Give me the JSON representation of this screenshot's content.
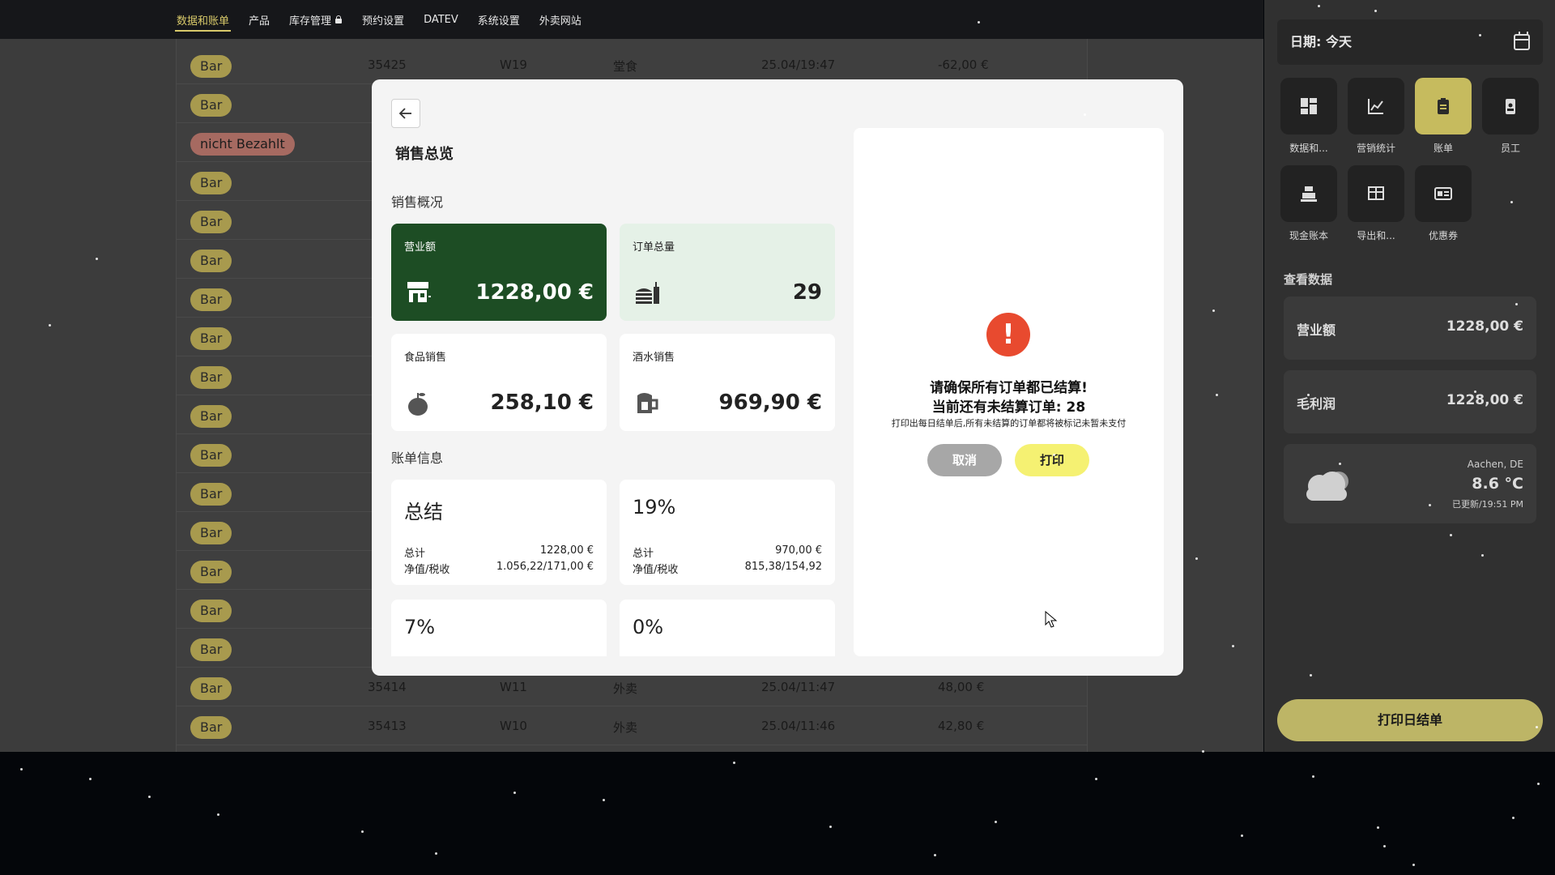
{
  "topnav": {
    "items": [
      {
        "label": "数据和账单",
        "active": true
      },
      {
        "label": "产品"
      },
      {
        "label": "库存管理",
        "locked": true
      },
      {
        "label": "预约设置"
      },
      {
        "label": "DATEV"
      },
      {
        "label": "系统设置"
      },
      {
        "label": "外卖网站"
      }
    ]
  },
  "orders": [
    {
      "status": "Bar",
      "id": "35425",
      "table": "W19",
      "type": "堂食",
      "time": "25.04/19:47",
      "amount": "-62,00 €"
    },
    {
      "status": "Bar"
    },
    {
      "status": "nicht Bezahlt"
    },
    {
      "status": "Bar"
    },
    {
      "status": "Bar"
    },
    {
      "status": "Bar"
    },
    {
      "status": "Bar"
    },
    {
      "status": "Bar"
    },
    {
      "status": "Bar"
    },
    {
      "status": "Bar"
    },
    {
      "status": "Bar"
    },
    {
      "status": "Bar"
    },
    {
      "status": "Bar"
    },
    {
      "status": "Bar"
    },
    {
      "status": "Bar"
    },
    {
      "status": "Bar"
    },
    {
      "status": "Bar",
      "id": "35414",
      "table": "W11",
      "type": "外卖",
      "time": "25.04/11:47",
      "amount": "48,00 €"
    },
    {
      "status": "Bar",
      "id": "35413",
      "table": "W10",
      "type": "外卖",
      "time": "25.04/11:46",
      "amount": "42,80 €"
    }
  ],
  "sidebar": {
    "date_label": "日期: 今天",
    "tiles": [
      {
        "label": "数据和...",
        "icon": "dashboard-icon"
      },
      {
        "label": "营销统计",
        "icon": "line-chart-icon"
      },
      {
        "label": "账单",
        "icon": "clipboard-icon",
        "active": true
      },
      {
        "label": "员工",
        "icon": "id-badge-icon"
      },
      {
        "label": "现金账本",
        "icon": "cash-register-icon"
      },
      {
        "label": "导出和...",
        "icon": "table-export-icon"
      },
      {
        "label": "优惠券",
        "icon": "coupon-icon"
      }
    ],
    "section_title": "查看数据",
    "stats": [
      {
        "label": "营业额",
        "value": "1228,00 €"
      },
      {
        "label": "毛利润",
        "value": "1228,00 €"
      }
    ],
    "weather": {
      "city": "Aachen, DE",
      "temp": "8.6 °C",
      "updated": "已更新/19:51 PM"
    },
    "print_label": "打印日结单"
  },
  "modal": {
    "title": "销售总览",
    "overview_title": "销售概况",
    "cards": [
      {
        "label": "营业额",
        "value": "1228,00 €",
        "icon": "store-icon"
      },
      {
        "label": "订单总量",
        "value": "29",
        "icon": "food-icon"
      },
      {
        "label": "食品销售",
        "value": "258,10 €",
        "icon": "apple-icon"
      },
      {
        "label": "酒水销售",
        "value": "969,90 €",
        "icon": "beer-icon"
      }
    ],
    "bill_title": "账单信息",
    "bills": [
      {
        "head": "总结",
        "total_label": "总计",
        "total": "1228,00 €",
        "net_label": "净值/税收",
        "net": "1.056,22/171,00 €"
      },
      {
        "head": "19%",
        "total_label": "总计",
        "total": "970,00 €",
        "net_label": "净值/税收",
        "net": "815,38/154,92"
      },
      {
        "head": "7%"
      },
      {
        "head": "0%"
      }
    ],
    "warning": {
      "line1": "请确保所有订单都已结算!",
      "line2": "当前还有未结算订单: 28",
      "line3": "打印出每日结单后,所有未结算的订单都将被标记未暂未支付",
      "cancel": "取消",
      "print": "打印"
    }
  }
}
